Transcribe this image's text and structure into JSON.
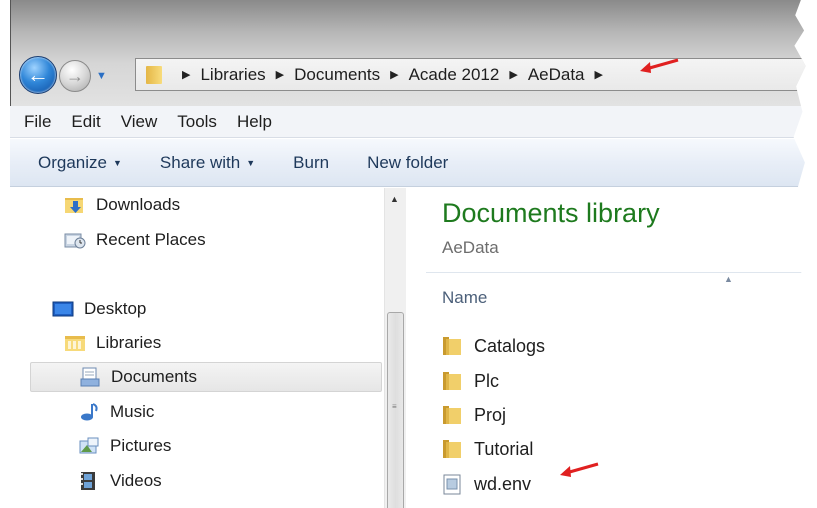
{
  "navigation": {
    "back_icon": "back-arrow-icon",
    "forward_icon": "forward-arrow-icon",
    "history_icon": "history-dropdown-icon"
  },
  "address": {
    "crumbs": [
      "Libraries",
      "Documents",
      "Acade 2012",
      "AeData"
    ],
    "separator": "▶"
  },
  "menu": [
    "File",
    "Edit",
    "View",
    "Tools",
    "Help"
  ],
  "toolbar": {
    "organize": "Organize",
    "share_with": "Share with",
    "burn": "Burn",
    "new_folder": "New folder"
  },
  "nav_pane": {
    "downloads": "Downloads",
    "recent_places": "Recent Places",
    "desktop": "Desktop",
    "libraries": "Libraries",
    "documents": "Documents",
    "music": "Music",
    "pictures": "Pictures",
    "videos": "Videos"
  },
  "content": {
    "title": "Documents library",
    "subtitle": "AeData",
    "column_name": "Name",
    "items": [
      "Catalogs",
      "Plc",
      "Proj",
      "Tutorial",
      "wd.env"
    ]
  },
  "colors": {
    "annotation_arrow": "#e02020",
    "library_title": "#1e7a1e",
    "toolbar_text": "#1e395b"
  }
}
